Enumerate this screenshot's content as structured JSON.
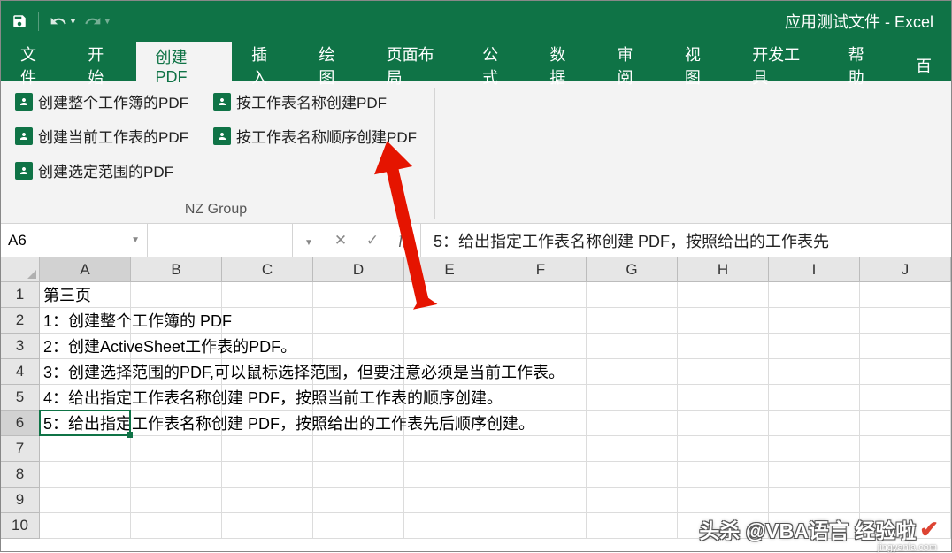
{
  "title": "应用测试文件  -  Excel",
  "tabs": {
    "file": "文件",
    "home": "开始",
    "createpdf": "创建PDF",
    "insert": "插入",
    "draw": "绘图",
    "pagelayout": "页面布局",
    "formulas": "公式",
    "data": "数据",
    "review": "审阅",
    "view": "视图",
    "developer": "开发工具",
    "help": "帮助",
    "bai": "百"
  },
  "ribbon": {
    "btn1": "创建整个工作簿的PDF",
    "btn2": "按工作表名称创建PDF",
    "btn3": "创建当前工作表的PDF",
    "btn4": "按工作表名称顺序创建PDF",
    "btn5": "创建选定范围的PDF",
    "group_label": "NZ Group"
  },
  "namebox": "A6",
  "formula_text": "5：给出指定工作表名称创建 PDF，按照给出的工作表先",
  "columns": [
    "A",
    "B",
    "C",
    "D",
    "E",
    "F",
    "G",
    "H",
    "I",
    "J"
  ],
  "rows": [
    "1",
    "2",
    "3",
    "4",
    "5",
    "6",
    "7",
    "8",
    "9",
    "10"
  ],
  "cell_data": {
    "r1": "第三页",
    "r2": "1：创建整个工作簿的 PDF",
    "r3": "2：创建ActiveSheet工作表的PDF。",
    "r4": "3：创建选择范围的PDF,可以鼠标选择范围，但要注意必须是当前工作表。",
    "r5": "4：给出指定工作表名称创建 PDF，按照当前工作表的顺序创建。",
    "r6": "5：给出指定工作表名称创建 PDF，按照给出的工作表先后顺序创建。"
  },
  "watermark_main": "头杀 @VBA语言 经验啦",
  "watermark_sub": "jingyanla.com"
}
